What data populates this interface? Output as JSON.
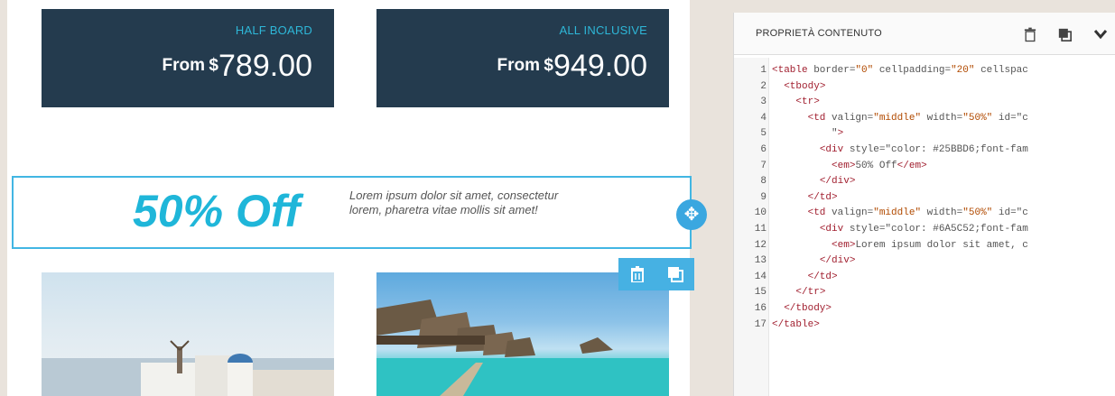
{
  "cards": [
    {
      "label": "HALF BOARD",
      "from": "From",
      "currency": "$",
      "amount": "789.00"
    },
    {
      "label": "ALL INCLUSIVE",
      "from": "From",
      "currency": "$",
      "amount": "949.00"
    }
  ],
  "promo": {
    "headline": "50% Off",
    "text": "Lorem ipsum dolor sit amet, consectetur lorem, pharetra vitae mollis sit amet!"
  },
  "icons": {
    "move": "✥",
    "trash": "🗑",
    "duplicate": "❐",
    "chevron": "⌄"
  },
  "panel": {
    "title": "PROPRIETÀ CONTENUTO"
  },
  "code": {
    "lines": [
      {
        "n": "1",
        "t": "<table border=\"0\" cellpadding=\"20\" cellspac"
      },
      {
        "n": "2",
        "t": "  <tbody>"
      },
      {
        "n": "3",
        "t": "    <tr>"
      },
      {
        "n": "4",
        "t": "      <td valign=\"middle\" width=\"50%\" id=\"c"
      },
      {
        "n": "5",
        "t": "          \">"
      },
      {
        "n": "6",
        "t": "        <div style=\"color: #25BBD6;font-fam"
      },
      {
        "n": "7",
        "t": "          <em>50% Off</em>"
      },
      {
        "n": "8",
        "t": "        </div>"
      },
      {
        "n": "9",
        "t": "      </td>"
      },
      {
        "n": "10",
        "t": "      <td valign=\"middle\" width=\"50%\" id=\"c"
      },
      {
        "n": "11",
        "t": "        <div style=\"color: #6A5C52;font-fam"
      },
      {
        "n": "12",
        "t": "          <em>Lorem ipsum dolor sit amet, c"
      },
      {
        "n": "13",
        "t": "        </div>"
      },
      {
        "n": "14",
        "t": "      </td>"
      },
      {
        "n": "15",
        "t": "    </tr>"
      },
      {
        "n": "16",
        "t": "  </tbody>"
      },
      {
        "n": "17",
        "t": "</table>"
      }
    ]
  }
}
